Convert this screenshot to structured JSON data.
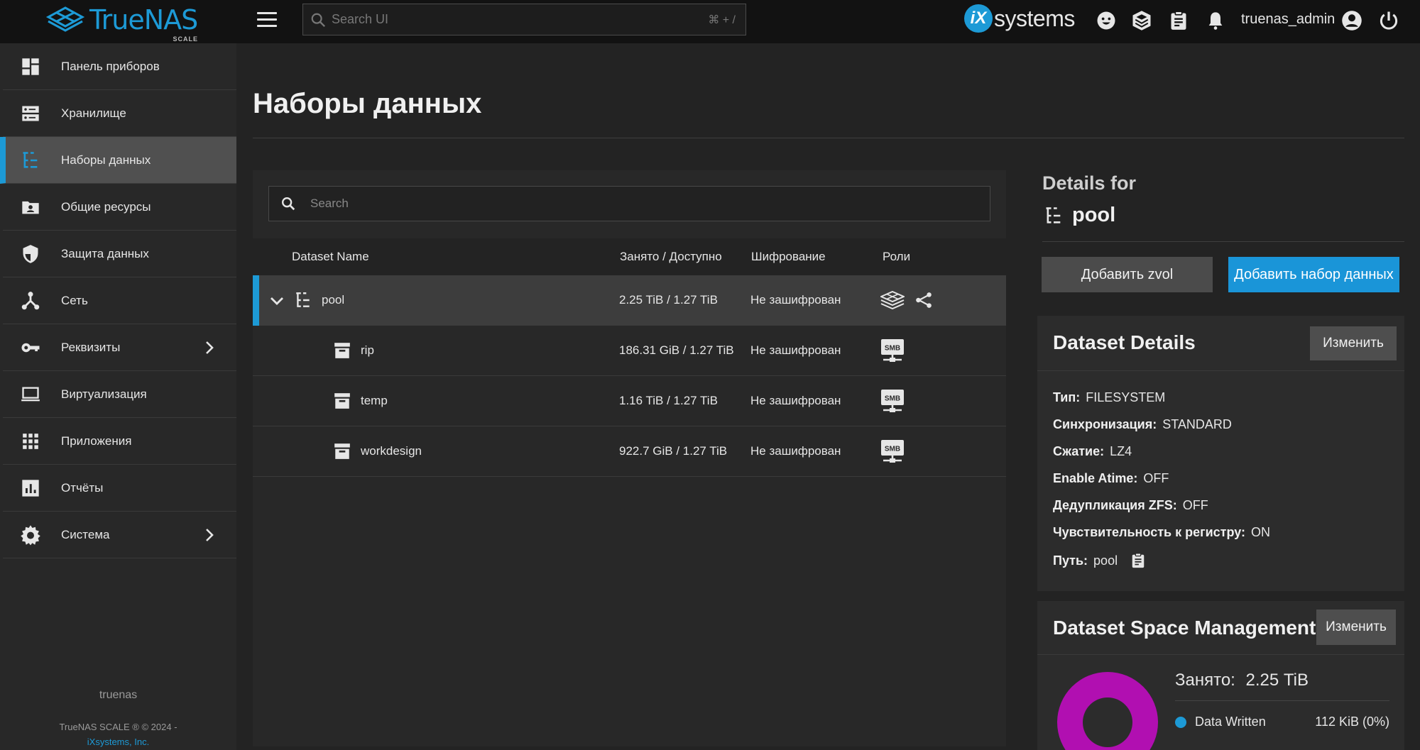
{
  "app": {
    "logo_text": "TrueNAS",
    "logo_sub": "SCALE",
    "vendor_text": "systems",
    "vendor_mark": "iX",
    "username": "truenas_admin"
  },
  "search": {
    "placeholder": "Search UI",
    "shortcut": "⌘ + /"
  },
  "sidebar": {
    "items": [
      {
        "label": "Панель приборов",
        "icon": "dashboard-icon"
      },
      {
        "label": "Хранилище",
        "icon": "storage-icon"
      },
      {
        "label": "Наборы данных",
        "icon": "datasets-icon"
      },
      {
        "label": "Общие ресурсы",
        "icon": "shares-icon"
      },
      {
        "label": "Защита данных",
        "icon": "shield-icon"
      },
      {
        "label": "Сеть",
        "icon": "network-icon"
      },
      {
        "label": "Реквизиты",
        "icon": "key-icon"
      },
      {
        "label": "Виртуализация",
        "icon": "laptop-icon"
      },
      {
        "label": "Приложения",
        "icon": "apps-grid-icon"
      },
      {
        "label": "Отчёты",
        "icon": "reports-chart-icon"
      },
      {
        "label": "Система",
        "icon": "gear-icon"
      }
    ],
    "active_index": 2,
    "hostname": "truenas",
    "copyright": "TrueNAS SCALE ® © 2024 -",
    "company": "iXsystems, Inc."
  },
  "page": {
    "title": "Наборы данных"
  },
  "tree": {
    "search_placeholder": "Search",
    "columns": {
      "name": "Dataset Name",
      "used": "Занято / Доступно",
      "encryption": "Шифрование",
      "roles": "Роли"
    },
    "rows": [
      {
        "name": "pool",
        "used": "2.25 TiB / 1.27 TiB",
        "encryption": "Не зашифрован",
        "roles": [
          "storage-cube-icon",
          "share-icon"
        ]
      },
      {
        "name": "rip",
        "used": "186.31 GiB / 1.27 TiB",
        "encryption": "Не зашифрован",
        "roles": [
          "smb-icon"
        ]
      },
      {
        "name": "temp",
        "used": "1.16 TiB / 1.27 TiB",
        "encryption": "Не зашифрован",
        "roles": [
          "smb-icon"
        ]
      },
      {
        "name": "workdesign",
        "used": "922.7 GiB / 1.27 TiB",
        "encryption": "Не зашифрован",
        "roles": [
          "smb-icon"
        ]
      }
    ],
    "smb_label": "SMB"
  },
  "details": {
    "heading": "Details for",
    "dataset": "pool",
    "add_zvol": "Добавить zvol",
    "add_dataset": "Добавить набор данных",
    "dataset_details": {
      "title": "Dataset Details",
      "edit": "Изменить",
      "props": [
        {
          "label": "Тип:",
          "value": "FILESYSTEM"
        },
        {
          "label": "Синхронизация:",
          "value": "STANDARD"
        },
        {
          "label": "Сжатие:",
          "value": "LZ4"
        },
        {
          "label": "Enable Atime:",
          "value": "OFF"
        },
        {
          "label": "Дедупликация ZFS:",
          "value": "OFF"
        },
        {
          "label": "Чувствительность к регистру:",
          "value": "ON"
        },
        {
          "label": "Путь:",
          "value": "pool"
        }
      ]
    },
    "space": {
      "title": "Dataset Space Management",
      "edit": "Изменить",
      "used_label": "Занято:",
      "used_value": "2.25 TiB",
      "legend_label": "Data Written",
      "legend_value": "112 KiB (0%)",
      "legend_color": "#1d9ad6",
      "donut_color": "#b10fb1"
    }
  }
}
